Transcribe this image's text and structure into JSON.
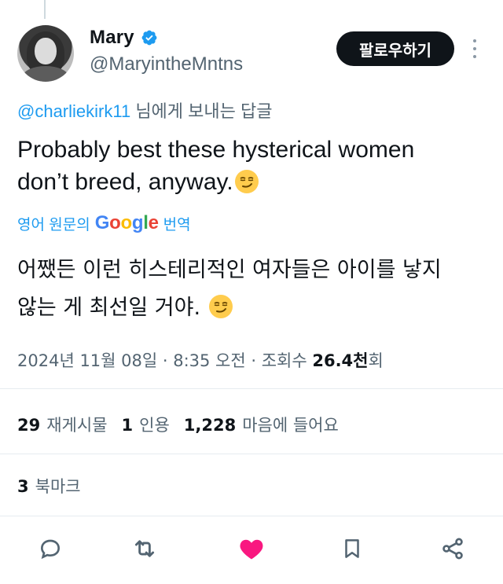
{
  "author": {
    "display_name": "Mary",
    "handle": "@MaryintheMntns",
    "verified": true,
    "avatar_icon": "profile-photo"
  },
  "follow_button": {
    "label": "팔로우하기"
  },
  "reply_context": {
    "mention": "@charliekirk11",
    "suffix": " 님에게 보내는 답글"
  },
  "tweet": {
    "line1": "Probably best these hysterical women",
    "line2": "don’t breed, anyway.",
    "emoji_icon": "smirking-face-emoji"
  },
  "translation_bar": {
    "prefix": "영어 원문의",
    "service": "Google",
    "suffix": "번역"
  },
  "translated_text": {
    "line1": "어쨌든 이런 히스테리적인 여자들은 아이를 낳지",
    "line2": "않는 게 최선일 거야."
  },
  "meta": {
    "date_time": "2024년 11월 08일 · 8:35 오전 · 조회수 ",
    "views_value": "26.4천",
    "views_suffix": "회"
  },
  "stats": {
    "reposts_count": "29",
    "reposts_label": "재게시물",
    "quotes_count": "1",
    "quotes_label": "인용",
    "likes_count": "1,228",
    "likes_label": "마음에 들어요"
  },
  "bookmarks": {
    "count": "3",
    "label": "북마크"
  },
  "colors": {
    "accent": "#1d9bf0",
    "like": "#f91880",
    "text_primary": "#0f1419",
    "text_secondary": "#536471",
    "icon": "#536471"
  },
  "action_icons": [
    "reply-icon",
    "repost-icon",
    "like-icon",
    "bookmark-icon",
    "share-icon"
  ]
}
